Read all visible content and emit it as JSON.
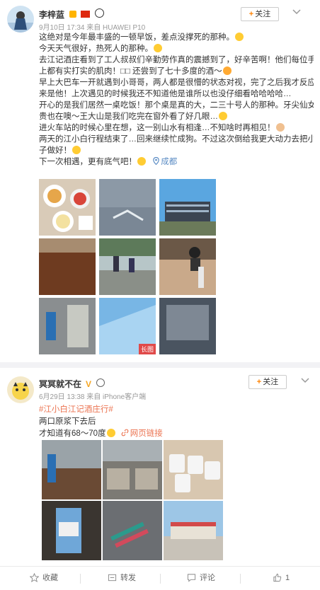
{
  "post1": {
    "username": "李梓蓝",
    "meta": "9月10日 17:34 来自 HUAWEI P10",
    "follow_label": "关注",
    "lines": [
      "这绝对是今年最丰盛的一顿早饭，差点没撑死的那种。",
      "今天天气很好，热死人的那种。",
      "去江记酒庄看到了工人叔叔们辛勤劳作真的震撼到了，好辛苦啊！他们每位手臂",
      "上都有实打实的肌肉！□□ 还尝到了七十多度的酒～",
      "早上大巴车一开就遇到小哥哥，两人都是很懵的状态对视，完了之后我才反应过",
      "来是他！上次遇见的时候我还不知道他是谁所以也没仔细看哈哈哈哈…",
      "开心的是我们居然一桌吃饭！那个桌是真的大，二三十号人的那种。牙尖仙女贵",
      "贵也在噢～王大山是我们吃完在窗外看了好几眼…",
      "进火车站的时候心里在想，这一别山水有相逢…不知啥时再相见！",
      "两天的江小白行程结束了…回来继续忙成狗。不过这次倒给我更大动力去把小圆",
      "子做好！",
      "下一次相遇，更有底气吧！"
    ],
    "location": "成都",
    "long_image_label": "长图"
  },
  "post2": {
    "username": "冥冥就不在",
    "meta": "6月29日 13:38 来自 iPhone客户端",
    "follow_label": "关注",
    "topic": "#江小白江记酒庄行#",
    "line1": "两口原浆下去后",
    "line2": "才知道有68～70度",
    "web_link": "网页链接"
  },
  "actions": {
    "favorite": "收藏",
    "repost": "转发",
    "comment": "评论",
    "like": "1"
  }
}
